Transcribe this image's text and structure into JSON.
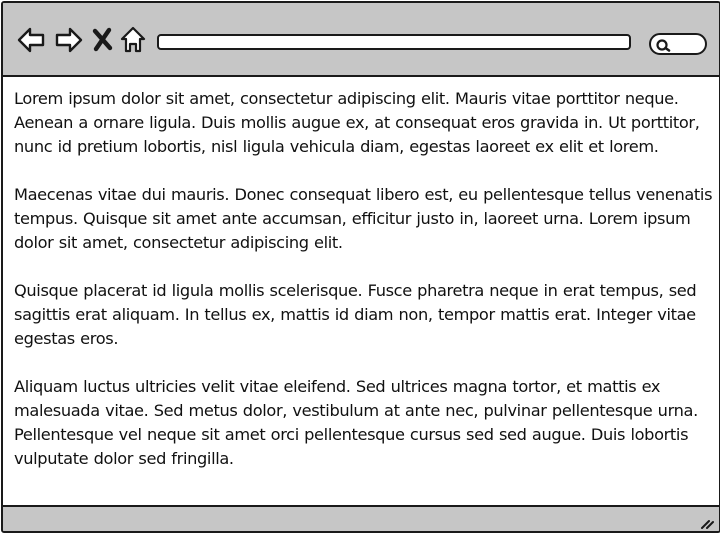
{
  "toolbar": {
    "back_icon": "arrow-left-icon",
    "forward_icon": "arrow-right-icon",
    "stop_icon": "close-x-icon",
    "home_icon": "home-icon",
    "address": "",
    "search_icon": "search-icon",
    "search_value": ""
  },
  "content": {
    "paragraphs": [
      "Lorem ipsum dolor sit amet, consectetur adipiscing elit. Mauris vitae porttitor neque. Aenean a ornare ligula. Duis mollis augue ex, at consequat eros gravida in. Ut porttitor, nunc id pretium lobortis, nisl ligula vehicula diam, egestas laoreet ex elit et lorem.",
      "Maecenas vitae dui mauris. Donec consequat libero est, eu pellentesque tellus venenatis tempus. Quisque sit amet ante accumsan, efficitur justo in, laoreet urna. Lorem ipsum dolor sit amet, consectetur adipiscing elit.",
      "Quisque placerat id ligula mollis scelerisque. Fusce pharetra neque in erat tempus, sed sagittis erat aliquam. In tellus ex, mattis id diam non, tempor mattis erat. Integer vitae egestas eros.",
      "Aliquam luctus ultricies velit vitae eleifend. Sed ultrices magna tortor, et mattis ex malesuada vitae. Sed metus dolor, vestibulum at ante nec, pulvinar pellentesque urna. Pellentesque vel neque sit amet orci pellentesque cursus sed sed augue. Duis lobortis vulputate dolor sed fringilla."
    ]
  },
  "statusbar": {
    "grip_icon": "resize-grip-icon"
  },
  "colors": {
    "chrome": "#c6c6c6",
    "outline": "#1a1a1a",
    "background": "#ffffff"
  }
}
